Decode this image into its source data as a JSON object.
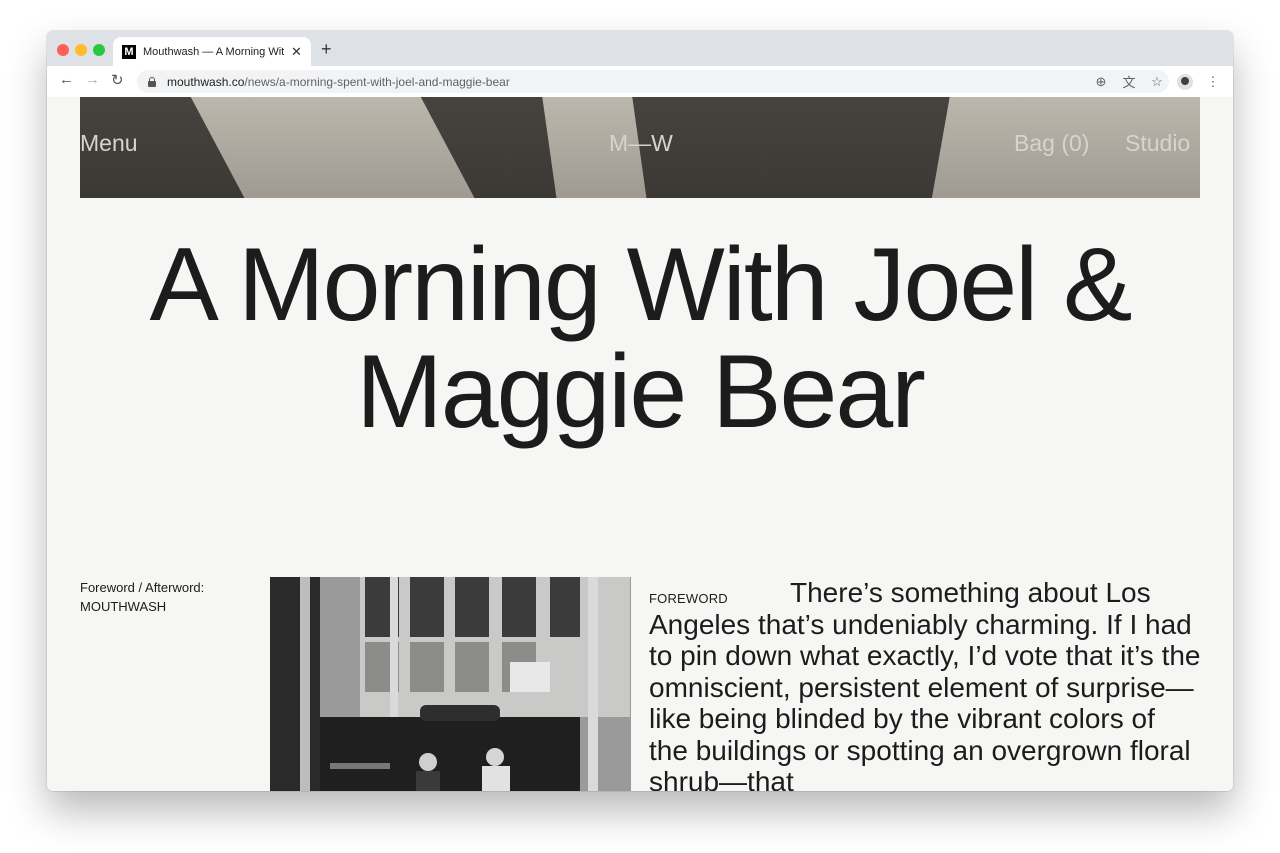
{
  "browser": {
    "tab_title": "Mouthwash — A Morning With J",
    "favicon_letter": "M",
    "close_glyph": "✕",
    "new_tab_glyph": "+",
    "back_glyph": "←",
    "forward_glyph": "→",
    "reload_glyph": "↻",
    "url_domain": "mouthwash.co",
    "url_path": "/news/a-morning-spent-with-joel-and-maggie-bear",
    "icons": [
      "add-circle-icon",
      "translate-icon",
      "star-icon",
      "profile-avatar",
      "kebab-menu-icon"
    ],
    "icon_glyphs": {
      "add": "⊕",
      "translate": "⽂",
      "star": "☆",
      "menu": "⋮"
    }
  },
  "site_nav": {
    "menu": "Menu",
    "logo": "M—W",
    "bag": "Bag (0)",
    "studio": "Studio"
  },
  "article": {
    "title": "A Morning With Joel & Maggie Bear",
    "credit_line1": "Foreword / Afterword:",
    "credit_line2": "MOUTHWASH",
    "section_label": "FOREWORD",
    "body": "There’s something about Los Angeles that’s undeniably charming. If I had to pin down what exactly, I’d vote that it’s the omniscient, persistent element of surprise—like being blinded by the vibrant colors of the buildings or spotting an overgrown floral shrub—that"
  },
  "colors": {
    "page_background": "#f6f6f4",
    "text": "#1c1c1c",
    "tab_strip": "#dee1e6"
  }
}
